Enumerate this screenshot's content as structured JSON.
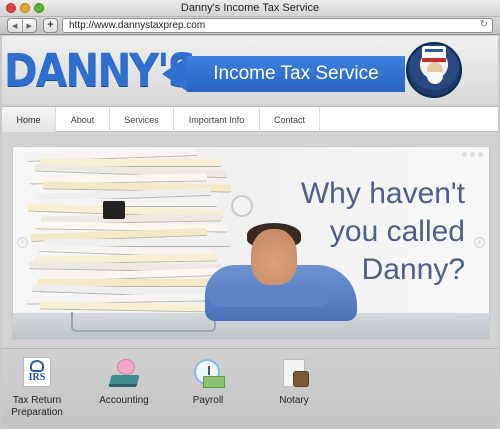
{
  "window": {
    "title": "Danny's Income Tax Service"
  },
  "toolbar": {
    "back_label": "◀",
    "forward_label": "▶",
    "add_label": "+",
    "url": "http://www.dannystaxprep.com",
    "reload_label": "↻"
  },
  "header": {
    "brand": "DANNY'S",
    "tagline": "Income Tax Service"
  },
  "nav": {
    "items": [
      {
        "label": "Home"
      },
      {
        "label": "About"
      },
      {
        "label": "Services"
      },
      {
        "label": "Important Info"
      },
      {
        "label": "Contact"
      }
    ]
  },
  "slider": {
    "headline": [
      "Why haven't",
      "you called",
      "Danny?"
    ],
    "prev_label": "‹",
    "next_label": "›"
  },
  "services": [
    {
      "label_line1": "Tax Return",
      "label_line2": "Preparation",
      "icon_text": "IRS"
    },
    {
      "label_line1": "Accounting"
    },
    {
      "label_line1": "Payroll"
    },
    {
      "label_line1": "Notary"
    }
  ],
  "colors": {
    "brand_blue": "#2f6fd0",
    "headline": "#4f5e8a"
  }
}
